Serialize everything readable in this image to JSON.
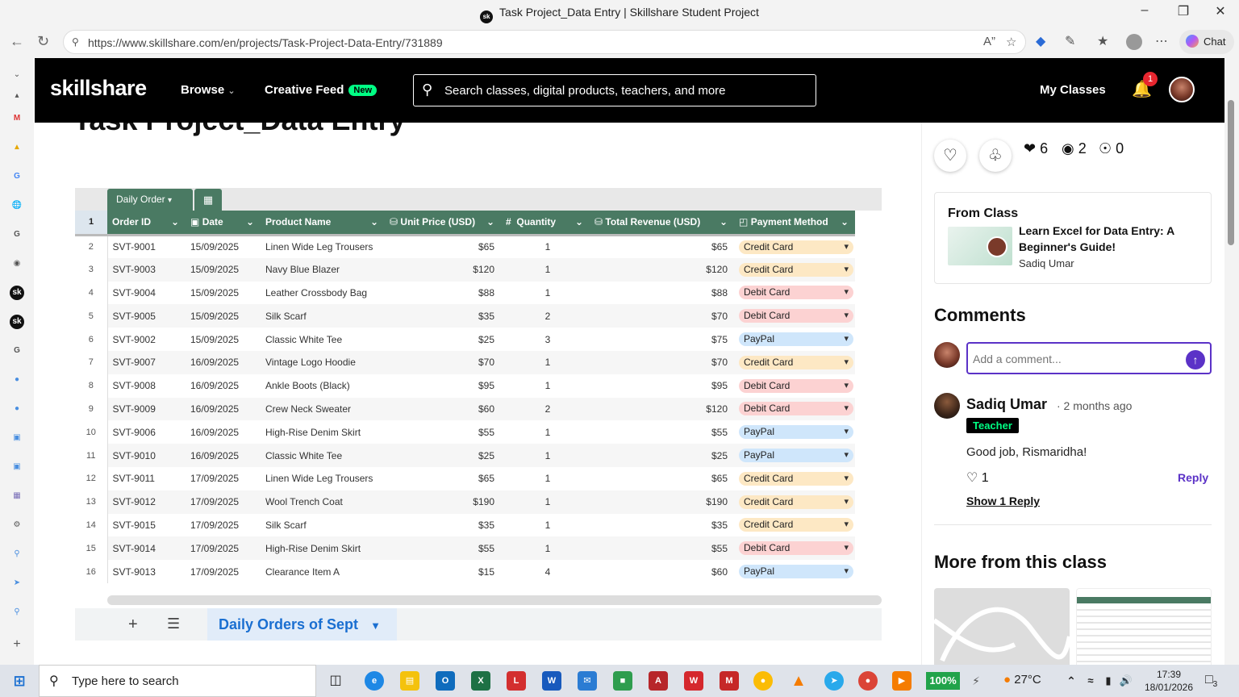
{
  "window": {
    "title": "Task Project_Data Entry | Skillshare Student Project",
    "tab_logo": "sk"
  },
  "browser": {
    "url": "https://www.skillshare.com/en/projects/Task-Project-Data-Entry/731889",
    "chat_label": "Chat"
  },
  "site": {
    "logo": "skillshare",
    "browse": "Browse",
    "creative_feed": "Creative Feed",
    "new_badge": "New",
    "search_placeholder": "Search classes, digital products, teachers, and more",
    "my_classes": "My Classes",
    "notification_count": "1"
  },
  "project": {
    "title": "Task Project_Data Entry"
  },
  "sheet": {
    "table_name": "Daily Order",
    "header_row_num": "1",
    "columns": [
      "Order ID",
      "Date",
      "Product Name",
      "Unit Price (USD)",
      "Quantity",
      "Total Revenue (USD)",
      "Payment Method"
    ],
    "column_icons": [
      "",
      "calendar-icon",
      "",
      "currency-icon",
      "hash-icon",
      "currency-icon",
      "status-icon"
    ],
    "rows": [
      {
        "n": "2",
        "id": "SVT-9001",
        "date": "15/09/2025",
        "product": "Linen Wide Leg Trousers",
        "price": "$65",
        "qty": "1",
        "total": "$65",
        "pay": "Credit Card"
      },
      {
        "n": "3",
        "id": "SVT-9003",
        "date": "15/09/2025",
        "product": "Navy Blue Blazer",
        "price": "$120",
        "qty": "1",
        "total": "$120",
        "pay": "Credit Card"
      },
      {
        "n": "4",
        "id": "SVT-9004",
        "date": "15/09/2025",
        "product": "Leather Crossbody Bag",
        "price": "$88",
        "qty": "1",
        "total": "$88",
        "pay": "Debit Card"
      },
      {
        "n": "5",
        "id": "SVT-9005",
        "date": "15/09/2025",
        "product": "Silk Scarf",
        "price": "$35",
        "qty": "2",
        "total": "$70",
        "pay": "Debit Card"
      },
      {
        "n": "6",
        "id": "SVT-9002",
        "date": "15/09/2025",
        "product": "Classic White Tee",
        "price": "$25",
        "qty": "3",
        "total": "$75",
        "pay": "PayPal"
      },
      {
        "n": "7",
        "id": "SVT-9007",
        "date": "16/09/2025",
        "product": "Vintage Logo Hoodie",
        "price": "$70",
        "qty": "1",
        "total": "$70",
        "pay": "Credit Card"
      },
      {
        "n": "8",
        "id": "SVT-9008",
        "date": "16/09/2025",
        "product": "Ankle Boots (Black)",
        "price": "$95",
        "qty": "1",
        "total": "$95",
        "pay": "Debit Card"
      },
      {
        "n": "9",
        "id": "SVT-9009",
        "date": "16/09/2025",
        "product": "Crew Neck Sweater",
        "price": "$60",
        "qty": "2",
        "total": "$120",
        "pay": "Debit Card"
      },
      {
        "n": "10",
        "id": "SVT-9006",
        "date": "16/09/2025",
        "product": "High-Rise Denim Skirt",
        "price": "$55",
        "qty": "1",
        "total": "$55",
        "pay": "PayPal"
      },
      {
        "n": "11",
        "id": "SVT-9010",
        "date": "16/09/2025",
        "product": "Classic White Tee",
        "price": "$25",
        "qty": "1",
        "total": "$25",
        "pay": "PayPal"
      },
      {
        "n": "12",
        "id": "SVT-9011",
        "date": "17/09/2025",
        "product": "Linen Wide Leg Trousers",
        "price": "$65",
        "qty": "1",
        "total": "$65",
        "pay": "Credit Card"
      },
      {
        "n": "13",
        "id": "SVT-9012",
        "date": "17/09/2025",
        "product": "Wool Trench Coat",
        "price": "$190",
        "qty": "1",
        "total": "$190",
        "pay": "Credit Card"
      },
      {
        "n": "14",
        "id": "SVT-9015",
        "date": "17/09/2025",
        "product": "Silk Scarf",
        "price": "$35",
        "qty": "1",
        "total": "$35",
        "pay": "Credit Card"
      },
      {
        "n": "15",
        "id": "SVT-9014",
        "date": "17/09/2025",
        "product": "High-Rise Denim Skirt",
        "price": "$55",
        "qty": "1",
        "total": "$55",
        "pay": "Debit Card"
      },
      {
        "n": "16",
        "id": "SVT-9013",
        "date": "17/09/2025",
        "product": "Clearance Item A",
        "price": "$15",
        "qty": "4",
        "total": "$60",
        "pay": "PayPal"
      }
    ],
    "active_tab": "Daily Orders of Sept"
  },
  "engagement": {
    "likes": "6",
    "comments": "2",
    "views": "0"
  },
  "from_class": {
    "label": "From Class",
    "title": "Learn Excel for Data Entry: A Beginner's Guide!",
    "author": "Sadiq Umar"
  },
  "comments": {
    "heading": "Comments",
    "placeholder": "Add a comment...",
    "items": [
      {
        "name": "Sadiq Umar",
        "time": "· 2 months ago",
        "tag": "Teacher",
        "text": "Good job, Rismaridha!",
        "likes": "1",
        "reply": "Reply",
        "show_replies": "Show 1 Reply"
      }
    ]
  },
  "more": {
    "heading": "More from this class"
  },
  "taskbar": {
    "search_placeholder": "Type here to search",
    "battery": "100%",
    "weather": "27°C",
    "time": "17:39",
    "date": "18/01/2026",
    "notif_count": "3"
  },
  "colors": {
    "sheet_header": "#4a7a63",
    "credit_card": "#fde8c4",
    "debit_card": "#fcd2d2",
    "paypal": "#cfe6fb",
    "accent": "#5b32c7",
    "teacher_tag": "#00ff84"
  }
}
